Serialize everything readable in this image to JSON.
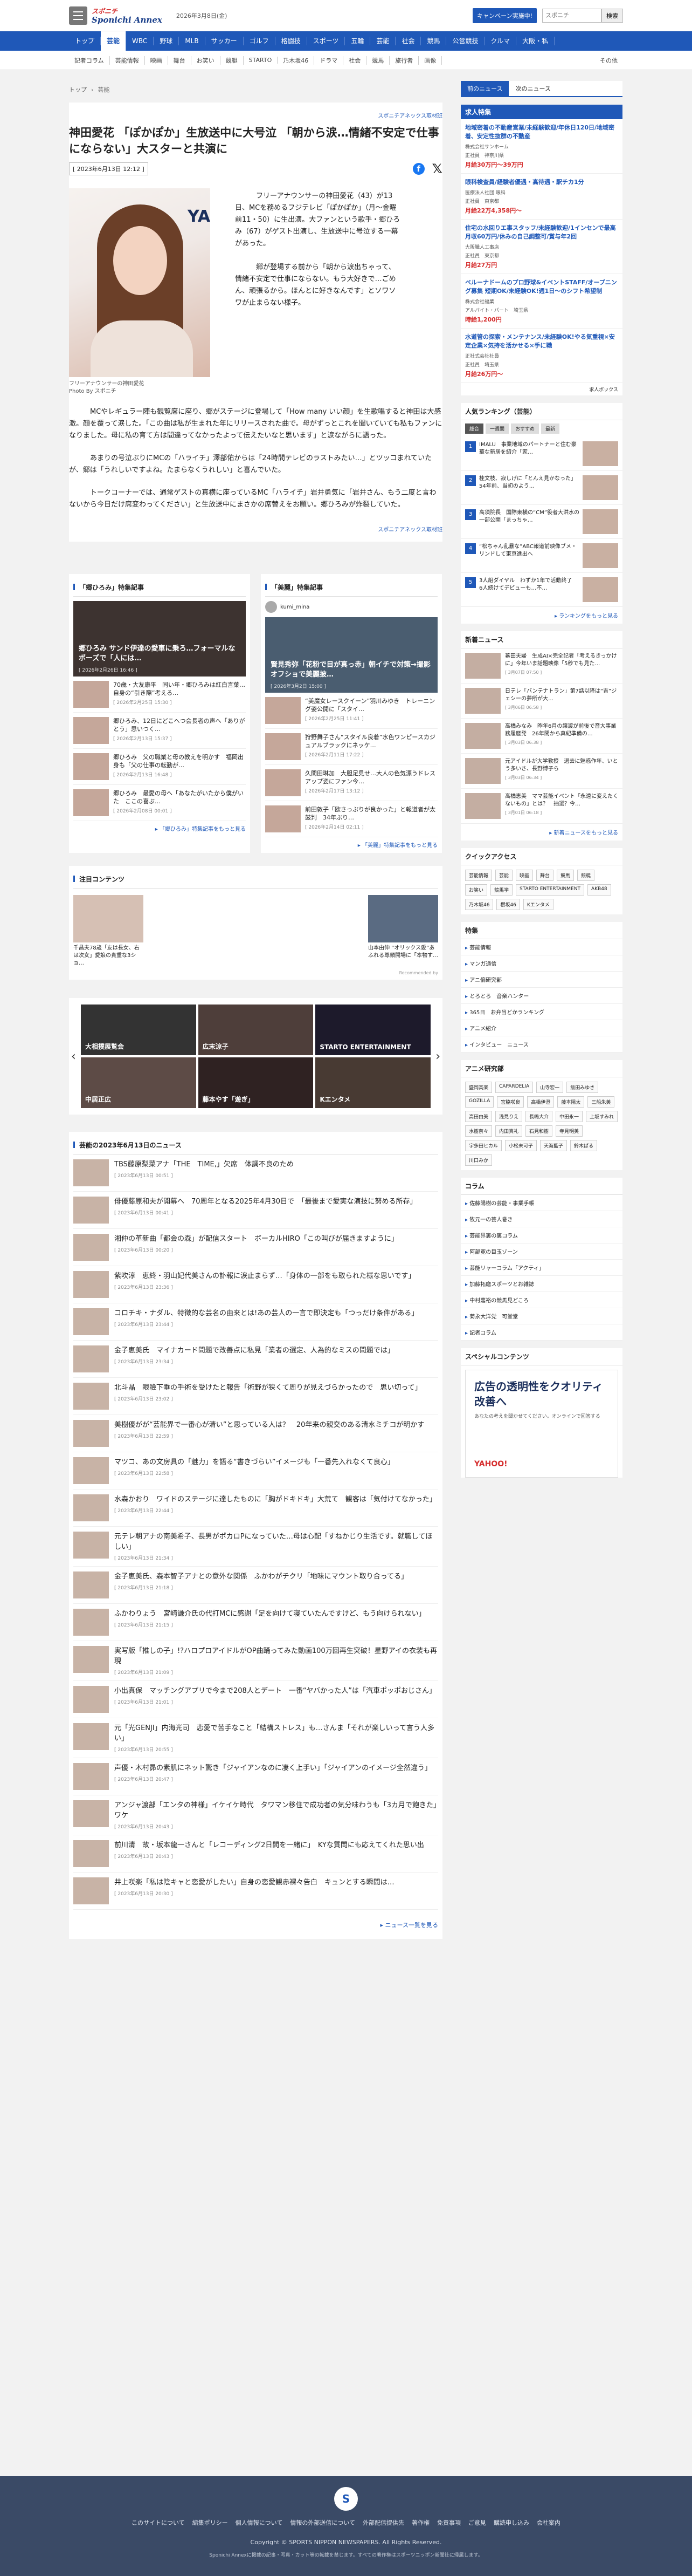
{
  "header": {
    "logo_top": "スポニチ",
    "logo_bottom": "Sponichi Annex",
    "date": "2026年3月8日(金)",
    "campaign": "キャンペーン実施中!",
    "search_placeholder": "スポニチ",
    "search_button": "検索"
  },
  "nav": [
    "トップ",
    "芸能",
    "WBC",
    "野球",
    "MLB",
    "サッカー",
    "ゴルフ",
    "格闘技",
    "スポーツ",
    "五輪",
    "芸能",
    "社会",
    "競馬",
    "公営競技",
    "クルマ",
    "大阪・私"
  ],
  "subnav": [
    "記者コラム",
    "芸能情報",
    "映画",
    "舞台",
    "お笑い",
    "競艇",
    "STARTO",
    "乃木坂46",
    "ドラマ",
    "社会",
    "競馬",
    "旅行者",
    "画像"
  ],
  "subnav_more": "その他",
  "crumb": [
    "トップ",
    "芸能"
  ],
  "article": {
    "source": "スポニチアネックス取材班",
    "title": "神田愛花 「ぽかぽか」生放送中に大号泣 「朝から涙…情緒不安定で仕事にならない」大スターと共演に",
    "date": "[ 2023年6月13日 12:12 ]",
    "caption": "フリーアナウンサーの神田愛花",
    "photo_by": "Photo By スポニチ",
    "p1": "フリーアナウンサーの神田愛花（43）が13日、MCを務めるフジテレビ「ぽかぽか」（月～金曜前11・50）に生出演。大ファンという歌手・郷ひろみ（67）がゲスト出演し、生放送中に号泣する一幕があった。",
    "p2": "郷が登場する前から「朝から涙出ちゃって、情緒不安定で仕事にならない。もう大好きで…ごめん、頑張るから。ほんとに好きなんです」とソワソワが止まらない様子。",
    "p3": "MCやレギュラー陣も観覧席に座り、郷がステージに登場して「How many いい顔」を生歌唱すると神田は大感激。顔を覆って涙した。「この曲は私が生まれた年にリリースされた曲で。母がずっとこれを聞いていても私もファンになりました。母に私の育て方は間違ってなかったよって伝えたいなと思います」と涙ながらに語った。",
    "p4": "あまりの号泣ぶりにMCの「ハライチ」澤部佑からは「24時間テレビのラストみたい…」とツッコまれていたが、郷は「うれしいですよね。たまらなくうれしい」と喜んでいた。",
    "p5": "トークコーナーでは、通常ゲストの真横に座っているMC「ハライチ」岩井勇気に「岩井さん、もう二度と言わないから今日だけ席変わってください」と生放送中にまさかの席替えをお願い。郷ひろみが炸裂していた。",
    "source2": "スポニチアネックス取材班"
  },
  "specials": [
    {
      "title": "「郷ひろみ」特集記事",
      "hero_t": "郷ひろみ サンド伊達の愛車に乗ろ…フォーマルなポーズで「人には…",
      "hero_d": "[ 2026年2月26日 16:46 ]",
      "items": [
        {
          "t": "70歳・大友康平　同い年・郷ひろみは紅白言葉…自身の“引き際”考える…",
          "d": "[ 2026年2月25日 15:30 ]"
        },
        {
          "t": "郷ひろみ、12日にどこへつ会長者の声へ「ありがとう」思いつく…",
          "d": "[ 2026年2月13日 15:37 ]"
        },
        {
          "t": "郷ひろみ　父の職業と母の教えを明かす　福岡出身も「父の仕事の転勤が…",
          "d": "[ 2026年2月13日 16:48 ]"
        },
        {
          "t": "郷ひろみ　最愛の母へ「あなたがいたから僕がいた　ここの喜ぶ…",
          "d": "[ 2026年2月08日 00:01 ]"
        }
      ],
      "more": "「郷ひろみ」特集記事をもっと見る"
    },
    {
      "title": "「美麗」特集記事",
      "head": "kumi_mina",
      "hero_t": "賢見秀弥「花粉で目が真っ赤」朝イチで対策→撮影オフショで美麗披…",
      "hero_d": "[ 2026年3月2日 15:00 ]",
      "items": [
        {
          "t": "“美魔女レースクイーン”羽川みゆき　トレーニング姿公開に「スタイ…",
          "d": "[ 2026年2月25日 11:41 ]"
        },
        {
          "t": "狩野舞子さん“スタイル良着”水色ワンピースカジュアルブラックにネッケ…",
          "d": "[ 2026年2月11日 17:22 ]"
        },
        {
          "t": "久間田琳加　大胆足見せ…大人の色気漂うドレスアップ姿にファン今…",
          "d": "[ 2026年2月17日 13:12 ]"
        },
        {
          "t": "前田敦子「欧さっぷりが良かった」と報道者が太鼓判　34年ぶり…",
          "d": "[ 2026年2月14日 02:11 ]"
        }
      ],
      "more": "「美麗」特集記事をもっと見る"
    }
  ],
  "attention": {
    "title": "注目コンテンツ",
    "items": [
      {
        "t": "千昌夫78歳「友は長女、右は次女」愛娘の貴重な3ショ…"
      },
      {
        "t": "山本由伸 “オリックス愛”あふれる尊顔開場に「本物す…"
      }
    ],
    "recommend": "Recommended by"
  },
  "carousel": [
    "大相撲展覧会",
    "広末涼子",
    "STARTO ENTERTAINMENT",
    "中居正広",
    "藤本やす「遊ぎ」",
    "Kエンタメ"
  ],
  "news": {
    "title": "芸能の2023年6月13日のニュース",
    "items": [
      {
        "t": "TBS藤原梨菜アナ「THE　TIME,」欠席　体調不良のため",
        "d": "[ 2023年6月13日 00:51 ]"
      },
      {
        "t": "俳優藤原和夫が開幕へ　70周年となる2025年4月30日で　「最後まで愛実な演技に努める所存」",
        "d": "[ 2023年6月13日 00:41 ]"
      },
      {
        "t": "湘仲の革新曲「都会の森」が配信スタート　ボーカルHIRO「この叫びが届きますように」",
        "d": "[ 2023年6月13日 00:20 ]"
      },
      {
        "t": "紫吹淳　恵終・羽山妃代美さんの訃報に涙止まらず…「身体の一部をも取られた様な思いです」",
        "d": "[ 2023年6月13日 23:36 ]"
      },
      {
        "t": "コロチキ・ナダル、特徴的な芸名の由来とは!あの芸人の一言で即決定も「つっだけ条件がある」",
        "d": "[ 2023年6月13日 23:44 ]"
      },
      {
        "t": "金子恵美氏　マイナカード問題で改善点に私見「業者の選定、人為的なミスの問題では」",
        "d": "[ 2023年6月13日 23:34 ]"
      },
      {
        "t": "北斗晶　眼瞼下垂の手術を受けたと報告「術野が狭くて周りが見えづらかったので　思い切って」",
        "d": "[ 2023年6月13日 23:02 ]"
      },
      {
        "t": "美樹優がが“芸能界で一番心が清い”と思っている人は？　20年来の親交のある清水ミチコが明かす",
        "d": "[ 2023年6月13日 22:59 ]"
      },
      {
        "t": "マツコ、あの文房具の「魅力」を語る“書きづらい”イメージも「一番先入れなくて良心」",
        "d": "[ 2023年6月13日 22:58 ]"
      },
      {
        "t": "水森かおり　ワイドのステージに達したものに「胸がドキドキ」大荒て　観客は「気付けてなかった」",
        "d": "[ 2023年6月13日 22:44 ]"
      },
      {
        "t": "元テレ朝アナの南美希子、長男がポカロPになっていた…母は心配「すねかじり生活です。就職してほしい」",
        "d": "[ 2023年6月13日 21:34 ]"
      },
      {
        "t": "金子恵美氏、森本智子アナとの意外な関係　ふかわがチクリ「地味にマウント取り合ってる」",
        "d": "[ 2023年6月13日 21:18 ]"
      },
      {
        "t": "ふかわりょう　宮崎謙介氏の代打MCに感謝「足を向けて寝ていたんですけど、もう向けられない」",
        "d": "[ 2023年6月13日 21:15 ]"
      },
      {
        "t": "実写版「推しの子」!?ハロプロアイドルがOP曲踊ってみた動画100万回再生突破！星野アイの衣装も再現",
        "d": "[ 2023年6月13日 21:09 ]"
      },
      {
        "t": "小出真保　マッチングアプリで今まで208人とデート　一番“ヤバかった人”は「汽車ポッポおじさん」",
        "d": "[ 2023年6月13日 21:01 ]"
      },
      {
        "t": "元「光GENJI」内海光司　恋愛で苦手なこと「結構ストレス」も…さんま「それが楽しいって言う人多い」",
        "d": "[ 2023年6月13日 20:55 ]"
      },
      {
        "t": "声優・木村昴の素肌にネット驚き「ジャイアンなのに凄く上手い」「ジャイアンのイメージ全然違う」",
        "d": "[ 2023年6月13日 20:47 ]"
      },
      {
        "t": "アンジャ渡部「エンタの神様」イケイケ時代　タワマン移住で成功者の気分味わうも「3カ月で飽きた」ワケ",
        "d": "[ 2023年6月13日 20:43 ]"
      },
      {
        "t": "前川清　故・坂本龍一さんと「レコーディング2日間を一緒に」　KYな質問にも応えてくれた思い出",
        "d": "[ 2023年6月13日 20:43 ]"
      },
      {
        "t": "井上咲楽「私は陰キャと恋愛がしたい」自身の恋愛観赤裸々告白　キュンとする瞬間は…",
        "d": "[ 2023年6月13日 20:30 ]"
      }
    ],
    "more": "ニュース一覧を見る"
  },
  "side": {
    "tabs": [
      "前のニュース",
      "次のニュース"
    ],
    "jobs_title": "求人特集",
    "jobs": [
      {
        "t": "地域密着の不動産営業/未経験歓迎/年休日120日/地域密着、安定性抜群の不動産",
        "c": "株式会社サンホーム",
        "tag": "正社員",
        "loc": "神奈川県",
        "w": "月給30万円〜39万円"
      },
      {
        "t": "眼科検査員/経験者優遇・高待遇・駅チカ1分",
        "c": "医療法人社団 眼科",
        "tag": "正社員",
        "loc": "東京都",
        "w": "月給22万4,358円〜"
      },
      {
        "t": "住宅の水回りエ事スタッフ/未経験歓迎/1インセンで最高月収60万円/休みの自己調整可/賞与年2回",
        "c": "大阪職人工事店",
        "tag": "正社員",
        "loc": "東京都",
        "w": "月給27万円"
      },
      {
        "t": "ベルーナドームのプロ野球&イベントSTAFF/オープニング募集 短期OK/未経験OK!週1日〜のシフト希望制",
        "c": "株式会社福業",
        "tag": "アルバイト・パート",
        "loc": "埼玉県",
        "w": "時給1,200円"
      },
      {
        "t": "水道管の探索・メンテナンス/未経験OK!やる気重視×安定企業×気持を活かせる×手に職",
        "c": "正社式会社社員",
        "tag": "正社員",
        "loc": "埼玉県",
        "w": "月給26万円〜"
      }
    ],
    "jobs_foot": "求人ボックス",
    "rank_title": "人気ランキング（芸能）",
    "rank_tabs": [
      "総合",
      "一週間",
      "おすすめ",
      "最新"
    ],
    "rank": [
      {
        "n": "1",
        "t": "IMALU　事業地域のパートナーと住む豪華な新居を紹介「家…"
      },
      {
        "n": "2",
        "t": "桂文枝、寂しげに「とんえ見かなった」54年前、当初のよう…"
      },
      {
        "n": "3",
        "t": "高須院長　国際東横の“CM”役者大洪水の一部公開「まっちゃ…"
      },
      {
        "n": "4",
        "t": "“松ちゃん乱暴な”ABC報道前映像ブメ・リンドして東京進出へ"
      },
      {
        "n": "5",
        "t": "3人組ダイヤル　わずか1年で活動終了　6人続けてデビューも…不…"
      }
    ],
    "rank_more": "ランキングをもっと見る",
    "new_title": "新着ニュース",
    "new": [
      {
        "t": "蕃田夫婦　生成AI×完全記者「考えるきっかけに」今年いま話題映像「5秒でも見た…",
        "d": "[ 3月07日 07:50 ]"
      },
      {
        "t": "日テレ「バンテナトラン」第7話以降は“吉”ジェシーの夢所が大…",
        "d": "[ 3月06日 06:58 ]"
      },
      {
        "t": "高橋みなみ　昨年6月の譲渡が前後で音大事業務履歴発　26年間から真紀準備の…",
        "d": "[ 3月03日 06:38 ]"
      },
      {
        "t": "元アイドルが大学教授　過去に魅惑作年、いとう多いさ、長野博子ら",
        "d": "[ 3月03日 06:34 ]"
      },
      {
        "t": "高橋恵美　ママ芸能イベント「永遠に変えたくないもの」とは？　抽選？今…",
        "d": "[ 3月01日 06:18 ]"
      }
    ],
    "new_more": "新着ニュースをもっと見る",
    "quick_title": "クイックアクセス",
    "quick": [
      "芸能情報",
      "芸能",
      "映画",
      "舞台",
      "競馬",
      "競艇",
      "お笑い",
      "競馬学",
      "STARTO ENTERTAINMENT",
      "AKB48",
      "乃木坂46",
      "櫻坂46",
      "Kエンタメ"
    ],
    "feature_title": "特集",
    "features": [
      "芸能情報",
      "マンガ通信",
      "アニ偏研究部",
      "とろとろ　音楽ハンター",
      "365日　お弁当どかランキング",
      "アニメ紹介",
      "インタビュー　ニュース"
    ],
    "anime_title": "アニメ研究部",
    "anime_tags": [
      "盛岡高楽",
      "CAPARDELIA",
      "山寺宏一",
      "飯田みゆき",
      "GOZILLA",
      "宮脇咲良",
      "高橋伊澄",
      "藤本陽太",
      "三船朱美",
      "高田由美",
      "浅見りえ",
      "長嶋大介",
      "中田永一",
      "上坂すみれ",
      "水樹奈々",
      "内田真礼",
      "石見和樹",
      "寺見明美",
      "宇多田ヒカル",
      "小松未可子",
      "天海藍子",
      "鈴木ぱる",
      "川口みか"
    ],
    "column_title": "コラム",
    "columns": [
      "佐藤陽樹の芸能・事業手帳",
      "牧元一の芸人巻き",
      "芸能界裏の裏コラム",
      "阿部寛の目玉ゾーン",
      "芸能リャーコラム「アクティ」",
      "加藤拓磨スポーツとお雑誌",
      "中村嘉裕の競馬見どころ",
      "菊永大洋党　可堂堂",
      "記者コラム"
    ],
    "special_title": "スペシャルコンテンツ",
    "ad_h": "広告の透明性をクオリティ改善へ",
    "ad_s": "あなたの考えを聞かせてください。オンラインで回答する",
    "ad_y": "YAHOO!"
  },
  "footer": {
    "links": [
      "このサイトについて",
      "編集ポリシー",
      "個人情報について",
      "情報の外部送信について",
      "外部配信提供先",
      "著作権",
      "免責事項",
      "ご意見",
      "購読申し込み",
      "会社案内"
    ],
    "copy": "Copyright © SPORTS NIPPON NEWSPAPERS. All Rights Reserved.",
    "note": "Sponichi Annexに掲載の記事・写真・カット等の転載を禁じます。すべての著作権はスポーツニッポン新聞社に帰属します。"
  }
}
